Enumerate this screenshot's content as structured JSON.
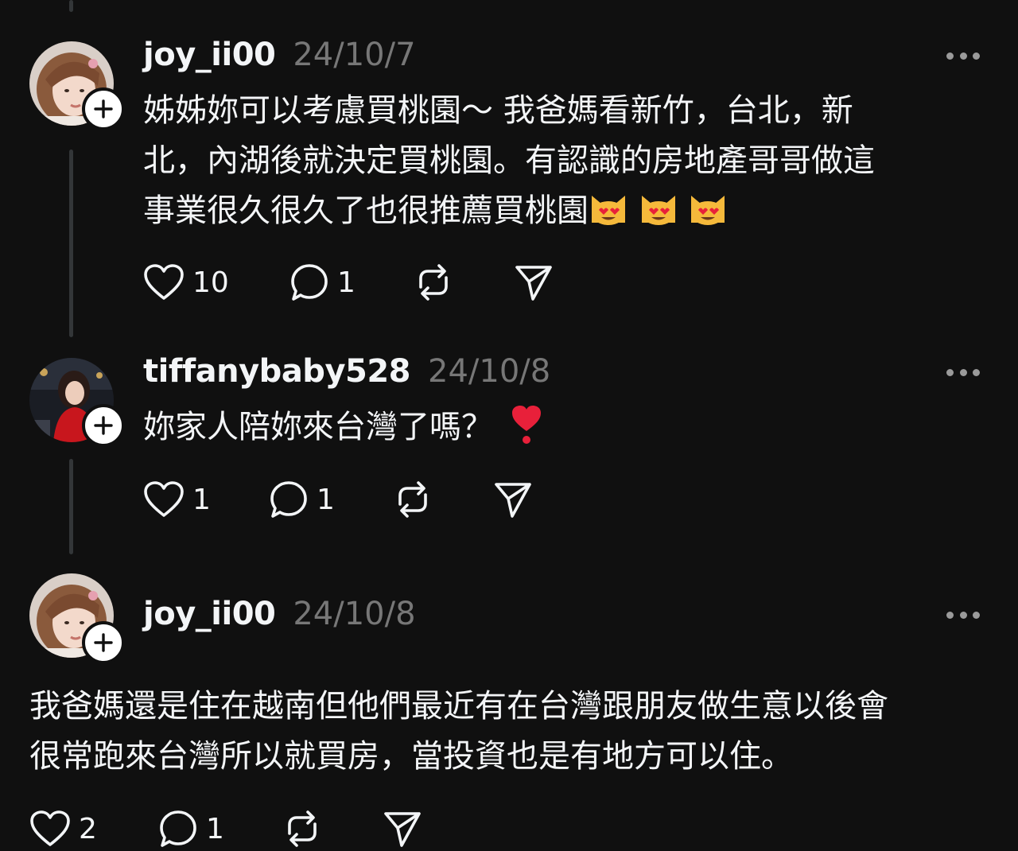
{
  "posts": [
    {
      "username": "joy_ii00",
      "timestamp": "24/10/7",
      "text": "姊姊妳可以考慮買桃園～ 我爸媽看新竹，台北，新\n北，內湖後就決定買桃園。有認識的房地產哥哥做這\n事業很久很久了也很推薦買桃園",
      "emoji": [
        "smiling-cat-heart-eyes",
        "smiling-cat-heart-eyes",
        "smiling-cat-heart-eyes"
      ],
      "likes": "10",
      "replies": "1"
    },
    {
      "username": "tiffanybaby528",
      "timestamp": "24/10/8",
      "text": "妳家人陪妳來台灣了嗎？",
      "emoji": [
        "heart-exclamation"
      ],
      "likes": "1",
      "replies": "1"
    },
    {
      "username": "joy_ii00",
      "timestamp": "24/10/8",
      "text": "我爸媽還是住在越南但他們最近有在台灣跟朋友做生意以後會\n很常跑來台灣所以就買房，當投資也是有地方可以住。",
      "likes": "2",
      "replies": "1"
    }
  ],
  "colors": {
    "background": "#101010",
    "primary_text": "#f3f5f7",
    "secondary_text": "#777777",
    "thread_line": "#333638"
  },
  "icons": [
    "heart-icon",
    "comment-icon",
    "repost-icon",
    "share-icon",
    "more-icon",
    "follow-plus-icon"
  ]
}
